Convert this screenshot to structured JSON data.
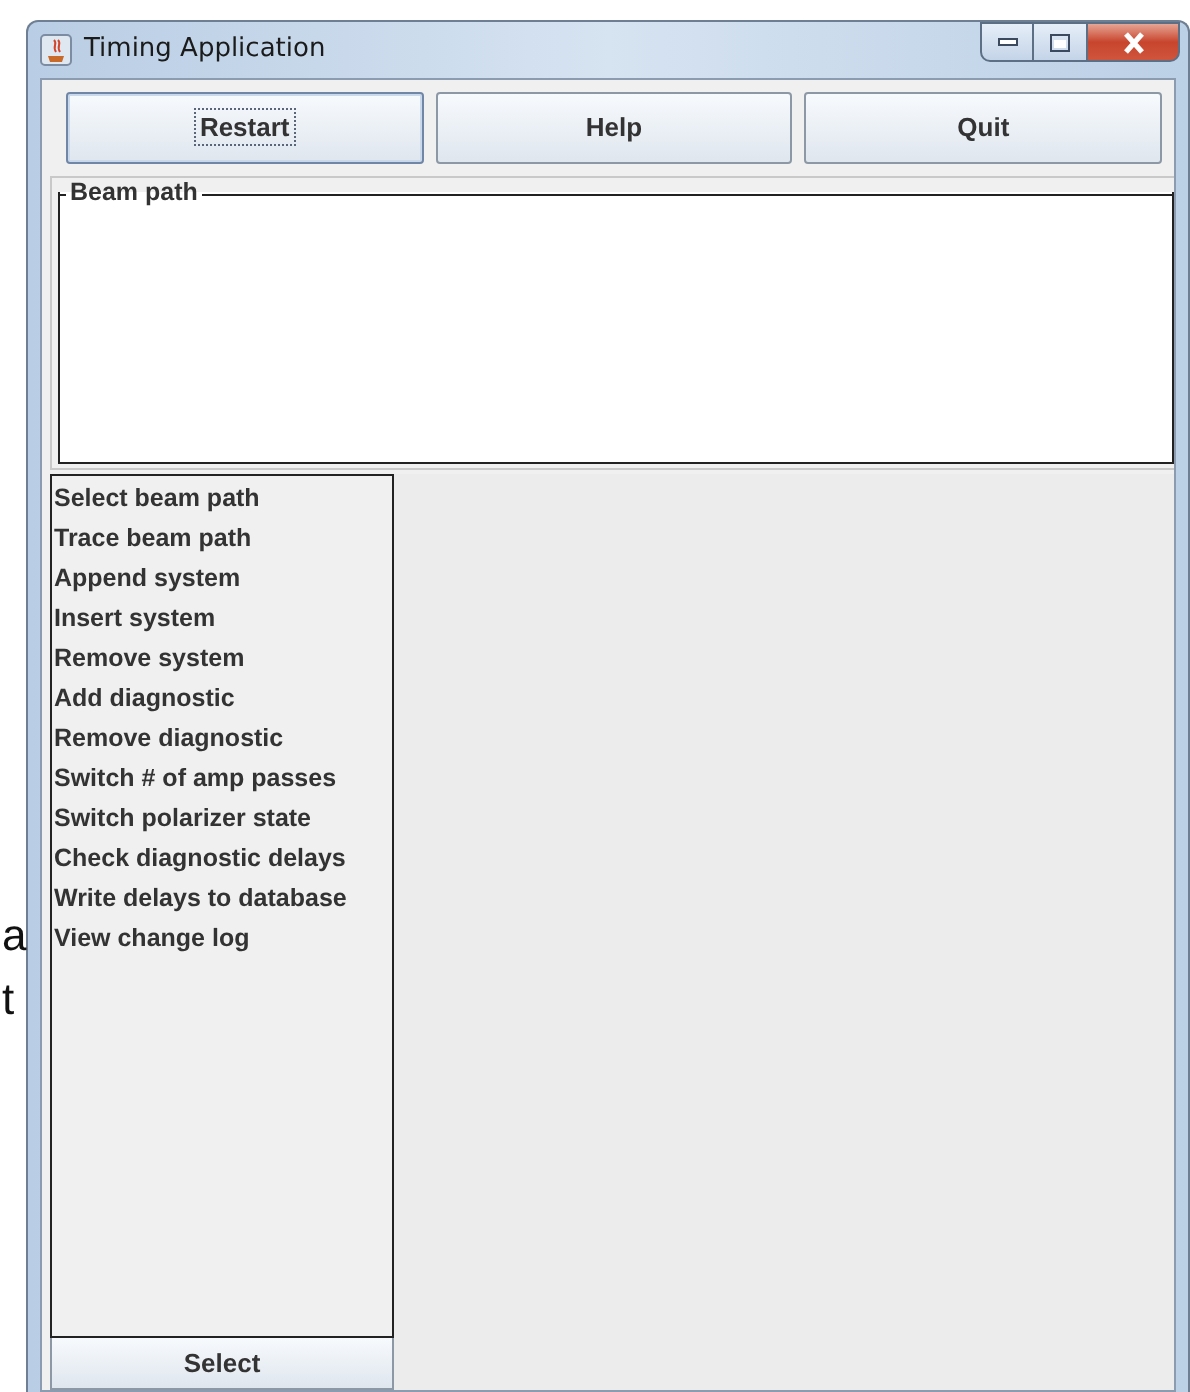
{
  "background_text": [
    "a",
    "t"
  ],
  "window": {
    "title": "Timing Application"
  },
  "buttons": [
    {
      "label": "Restart",
      "focused": true
    },
    {
      "label": "Help",
      "focused": false
    },
    {
      "label": "Quit",
      "focused": false
    }
  ],
  "beam_path": {
    "title": "Beam path"
  },
  "actions": [
    {
      "label": "Select beam path",
      "selected": false
    },
    {
      "label": "Trace beam path",
      "selected": false
    },
    {
      "label": "Append system",
      "selected": false
    },
    {
      "label": "Insert system",
      "selected": false
    },
    {
      "label": "Remove system",
      "selected": false
    },
    {
      "label": "Add diagnostic",
      "selected": false
    },
    {
      "label": "Remove diagnostic",
      "selected": false
    },
    {
      "label": "Switch # of amp passes",
      "selected": false
    },
    {
      "label": "Switch polarizer state",
      "selected": false
    },
    {
      "label": "Check diagnostic delays",
      "selected": false
    },
    {
      "label": "Write delays to database",
      "selected": false
    },
    {
      "label": "View change log",
      "selected": false
    }
  ],
  "select_button": {
    "label": "Select"
  }
}
